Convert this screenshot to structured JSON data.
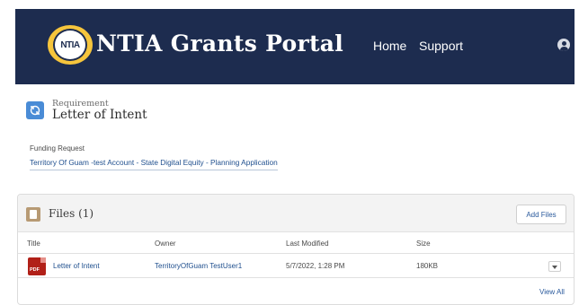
{
  "header": {
    "logo_text": "NTIA",
    "title": "NTIA Grants Portal",
    "nav": {
      "home": "Home",
      "support": "Support"
    }
  },
  "record": {
    "type_label": "Requirement",
    "name": "Letter of Intent"
  },
  "funding_request": {
    "label": "Funding Request",
    "link": "Territory Of Guam -test Account - State Digital Equity - Planning Application"
  },
  "files": {
    "title": "Files (1)",
    "add_button": "Add Files",
    "columns": [
      "Title",
      "Owner",
      "Last Modified",
      "Size"
    ],
    "rows": [
      {
        "icon_label": "PDF",
        "title": "Letter of Intent",
        "owner": "TerritoryOfGuam TestUser1",
        "last_modified": "5/7/2022, 1:28 PM",
        "size": "180KB"
      }
    ],
    "view_all": "View All"
  },
  "colors": {
    "header_bg": "#1d2c4f",
    "logo_ring": "#f6c53c",
    "link": "#1f4f8e",
    "pdf_icon": "#b12018"
  }
}
